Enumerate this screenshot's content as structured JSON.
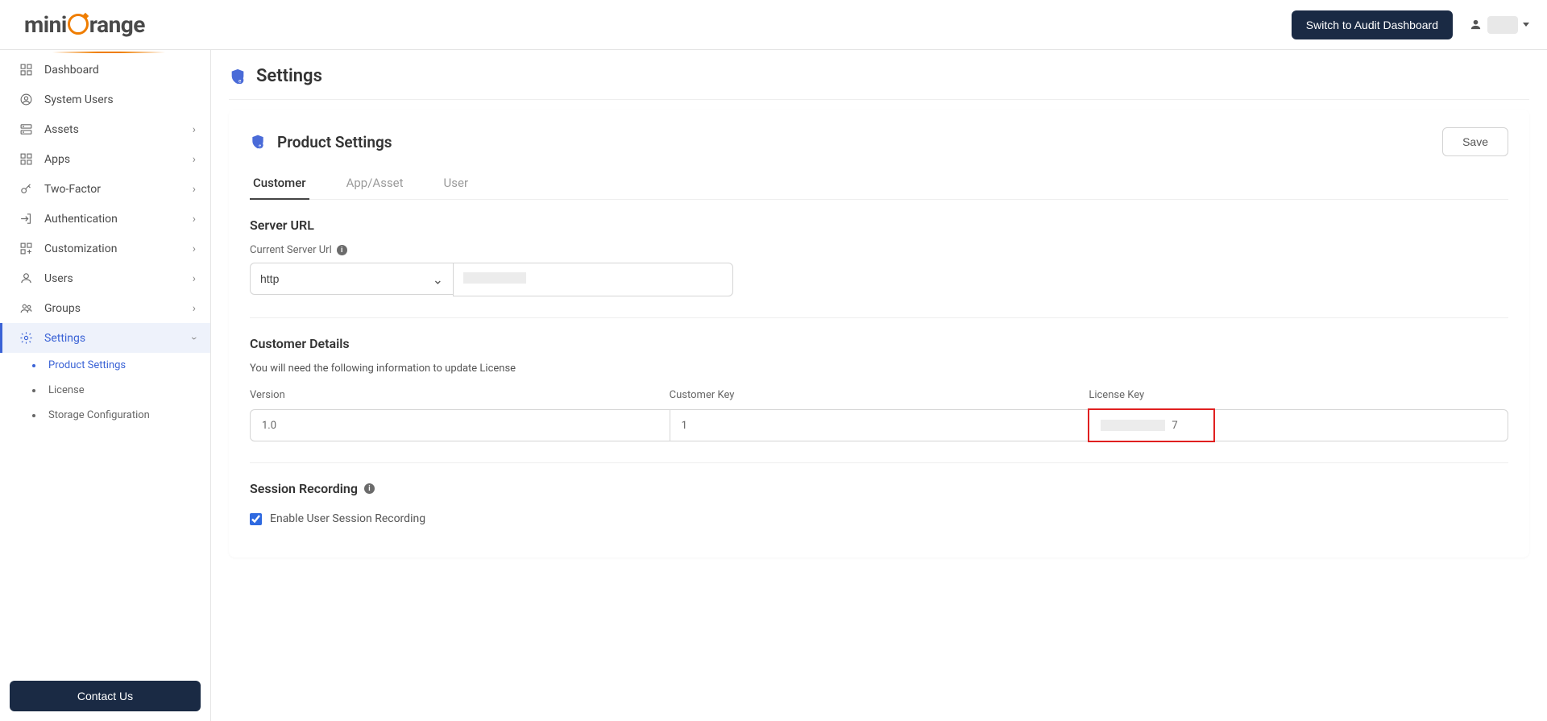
{
  "topbar": {
    "audit_button": "Switch to Audit Dashboard"
  },
  "sidebar": {
    "items": [
      {
        "label": "Dashboard",
        "icon": "dashboard",
        "expandable": false
      },
      {
        "label": "System Users",
        "icon": "user-circle",
        "expandable": false
      },
      {
        "label": "Assets",
        "icon": "server",
        "expandable": true
      },
      {
        "label": "Apps",
        "icon": "grid",
        "expandable": true
      },
      {
        "label": "Two-Factor",
        "icon": "key",
        "expandable": true
      },
      {
        "label": "Authentication",
        "icon": "login",
        "expandable": true
      },
      {
        "label": "Customization",
        "icon": "grid-plus",
        "expandable": true
      },
      {
        "label": "Users",
        "icon": "person",
        "expandable": true
      },
      {
        "label": "Groups",
        "icon": "people",
        "expandable": true
      },
      {
        "label": "Settings",
        "icon": "gear",
        "expandable": true,
        "active": true
      }
    ],
    "subitems": [
      {
        "label": "Product Settings",
        "active": true
      },
      {
        "label": "License",
        "active": false
      },
      {
        "label": "Storage Configuration",
        "active": false
      }
    ],
    "contact": "Contact Us"
  },
  "page": {
    "title": "Settings",
    "card_title": "Product Settings",
    "save": "Save"
  },
  "tabs": [
    "Customer",
    "App/Asset",
    "User"
  ],
  "server": {
    "heading": "Server URL",
    "label": "Current Server Url",
    "protocol": "http"
  },
  "customer": {
    "heading": "Customer Details",
    "subtext": "You will need the following information to update License",
    "version_label": "Version",
    "version_value": "1.0",
    "key_label": "Customer Key",
    "key_value": "1",
    "license_label": "License Key",
    "license_suffix": "7"
  },
  "session": {
    "heading": "Session Recording",
    "checkbox_label": "Enable User Session Recording"
  }
}
